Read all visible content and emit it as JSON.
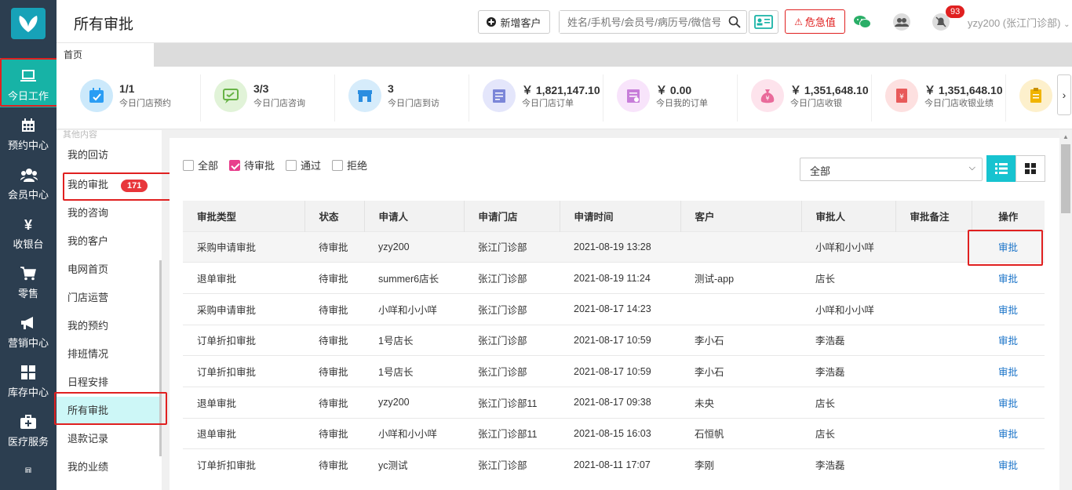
{
  "topbar": {
    "title": "所有审批",
    "add_customer": "新增客户",
    "search_placeholder": "姓名/手机号/会员号/病历号/微信号",
    "danger_label": "危急值",
    "notify_count": "93",
    "user": "yzy200 (张江门诊部)"
  },
  "sidebar": {
    "items": [
      {
        "label": "今日工作",
        "icon": "laptop-icon"
      },
      {
        "label": "预约中心",
        "icon": "calendar-icon"
      },
      {
        "label": "会员中心",
        "icon": "users-icon"
      },
      {
        "label": "收银台",
        "icon": "yen-icon"
      },
      {
        "label": "零售",
        "icon": "cart-icon"
      },
      {
        "label": "营销中心",
        "icon": "megaphone-icon"
      },
      {
        "label": "库存中心",
        "icon": "grid-icon"
      },
      {
        "label": "医疗服务",
        "icon": "medkit-icon"
      }
    ]
  },
  "tabs": {
    "home": "首页"
  },
  "stats": [
    {
      "value": "1/1",
      "label": "今日门店预约",
      "color": "#cce9fb",
      "icon": "calendar-check-icon"
    },
    {
      "value": "3/3",
      "label": "今日门店咨询",
      "color": "#e1f3d8",
      "icon": "consult-icon"
    },
    {
      "value": "3",
      "label": "今日门店到访",
      "color": "#d6ecfb",
      "icon": "store-icon"
    },
    {
      "value": "￥ 1,821,147.10",
      "label": "今日门店订单",
      "color": "#e4e6fb",
      "icon": "order-icon"
    },
    {
      "value": "￥ 0.00",
      "label": "今日我的订单",
      "color": "#f8e4fb",
      "icon": "my-order-icon"
    },
    {
      "value": "￥ 1,351,648.10",
      "label": "今日门店收银",
      "color": "#fde3ec",
      "icon": "money-bag-icon"
    },
    {
      "value": "￥ 1,351,648.10",
      "label": "今日门店收银业绩",
      "color": "#fde0e0",
      "icon": "invoice-icon"
    },
    {
      "value": "",
      "label": "",
      "color": "#fdf0cc",
      "icon": "clipboard-icon"
    }
  ],
  "menu": {
    "cut_heading": "其他内容",
    "items": [
      {
        "label": "我的回访"
      },
      {
        "label": "我的审批",
        "badge": "171"
      },
      {
        "label": "我的咨询"
      },
      {
        "label": "我的客户"
      },
      {
        "label": "电网首页"
      },
      {
        "label": "门店运营"
      },
      {
        "label": "我的预约"
      },
      {
        "label": "排班情况"
      },
      {
        "label": "日程安排"
      },
      {
        "label": "所有审批"
      },
      {
        "label": "退款记录"
      },
      {
        "label": "我的业绩"
      }
    ]
  },
  "filters": [
    {
      "label": "全部",
      "checked": false
    },
    {
      "label": "待审批",
      "checked": true
    },
    {
      "label": "通过",
      "checked": false
    },
    {
      "label": "拒绝",
      "checked": false
    }
  ],
  "select_value": "全部",
  "table": {
    "headers": [
      "审批类型",
      "状态",
      "申请人",
      "申请门店",
      "申请时间",
      "客户",
      "审批人",
      "审批备注",
      "操作"
    ],
    "rows": [
      [
        "采购申请审批",
        "待审批",
        "yzy200",
        "张江门诊部",
        "2021-08-19 13:28",
        "",
        "小咩和小小咩",
        "",
        "审批"
      ],
      [
        "退单审批",
        "待审批",
        "summer6店长",
        "张江门诊部",
        "2021-08-19 11:24",
        "测试-app",
        "店长",
        "",
        "审批"
      ],
      [
        "采购申请审批",
        "待审批",
        "小咩和小小咩",
        "张江门诊部",
        "2021-08-17 14:23",
        "",
        "小咩和小小咩",
        "",
        "审批"
      ],
      [
        "订单折扣审批",
        "待审批",
        "1号店长",
        "张江门诊部",
        "2021-08-17 10:59",
        "李小石",
        "李浩磊",
        "",
        "审批"
      ],
      [
        "订单折扣审批",
        "待审批",
        "1号店长",
        "张江门诊部",
        "2021-08-17 10:59",
        "李小石",
        "李浩磊",
        "",
        "审批"
      ],
      [
        "退单审批",
        "待审批",
        "yzy200",
        "张江门诊部11",
        "2021-08-17 09:38",
        "未央",
        "店长",
        "",
        "审批"
      ],
      [
        "退单审批",
        "待审批",
        "小咩和小小咩",
        "张江门诊部11",
        "2021-08-15 16:03",
        "石恒帆",
        "店长",
        "",
        "审批"
      ],
      [
        "订单折扣审批",
        "待审批",
        "yc测试",
        "张江门诊部",
        "2021-08-11 17:07",
        "李刚",
        "李浩磊",
        "",
        "审批"
      ]
    ]
  }
}
